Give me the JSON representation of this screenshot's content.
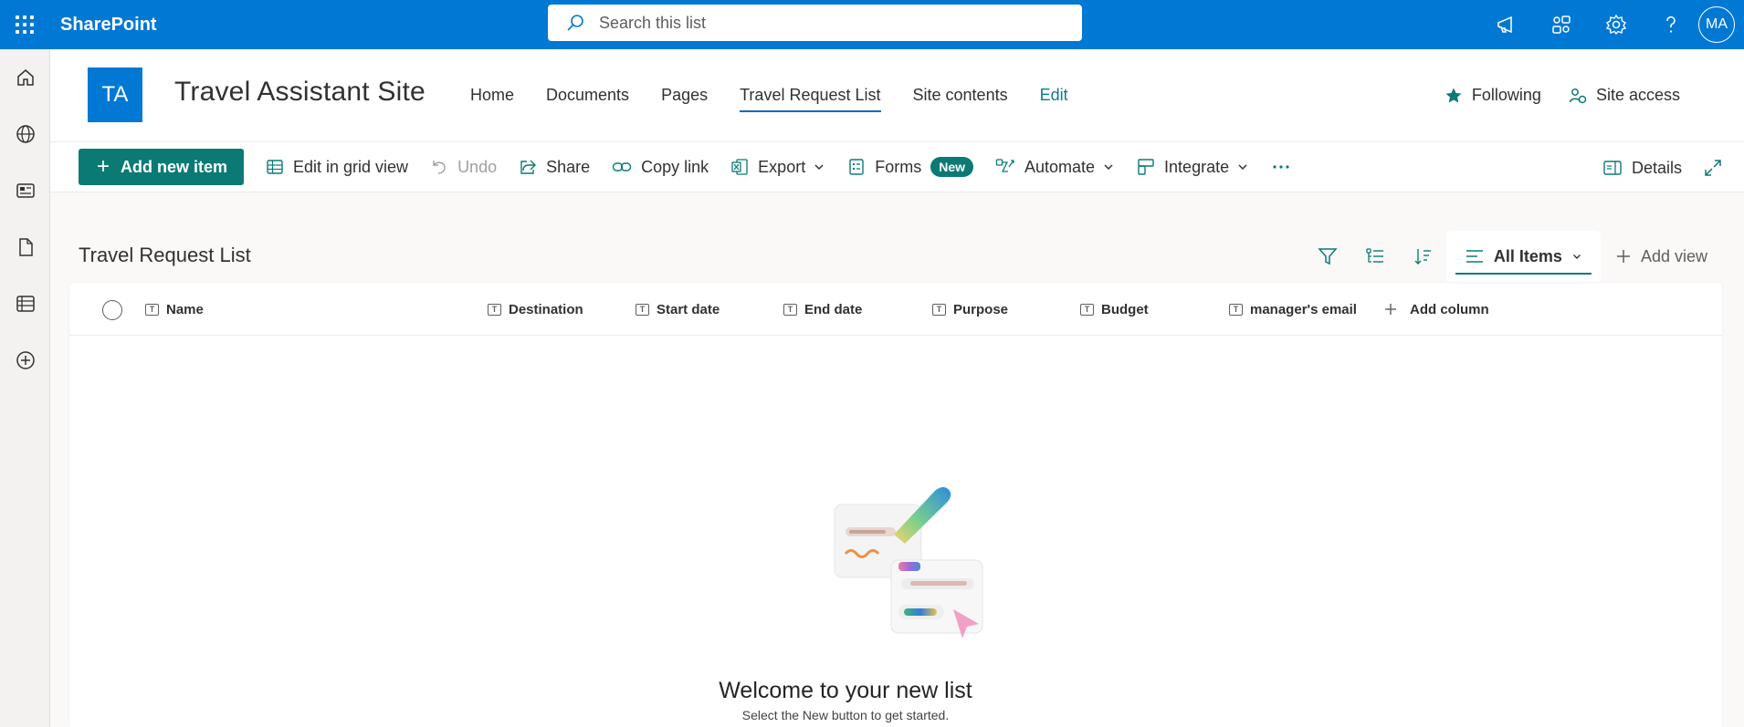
{
  "suite": {
    "brand": "SharePoint",
    "search_placeholder": "Search this list",
    "avatar_initials": "MA"
  },
  "site": {
    "logo_initials": "TA",
    "title": "Travel Assistant Site",
    "nav": [
      "Home",
      "Documents",
      "Pages",
      "Travel Request List",
      "Site contents",
      "Edit"
    ],
    "following_label": "Following",
    "site_access_label": "Site access"
  },
  "commands": {
    "add_new_item": "Add new item",
    "edit_grid": "Edit in grid view",
    "undo": "Undo",
    "share": "Share",
    "copy_link": "Copy link",
    "export": "Export",
    "forms": "Forms",
    "forms_badge": "New",
    "automate": "Automate",
    "integrate": "Integrate",
    "details": "Details"
  },
  "list": {
    "title": "Travel Request List",
    "view_name": "All Items",
    "add_view": "Add view",
    "columns": [
      "Name",
      "Destination",
      "Start date",
      "End date",
      "Purpose",
      "Budget",
      "manager's email"
    ],
    "add_column": "Add column",
    "empty_title": "Welcome to your new list",
    "empty_subtitle": "Select the New button to get started."
  },
  "colors": {
    "suite_blue": "#0078d4",
    "accent_teal": "#0b7a75"
  }
}
